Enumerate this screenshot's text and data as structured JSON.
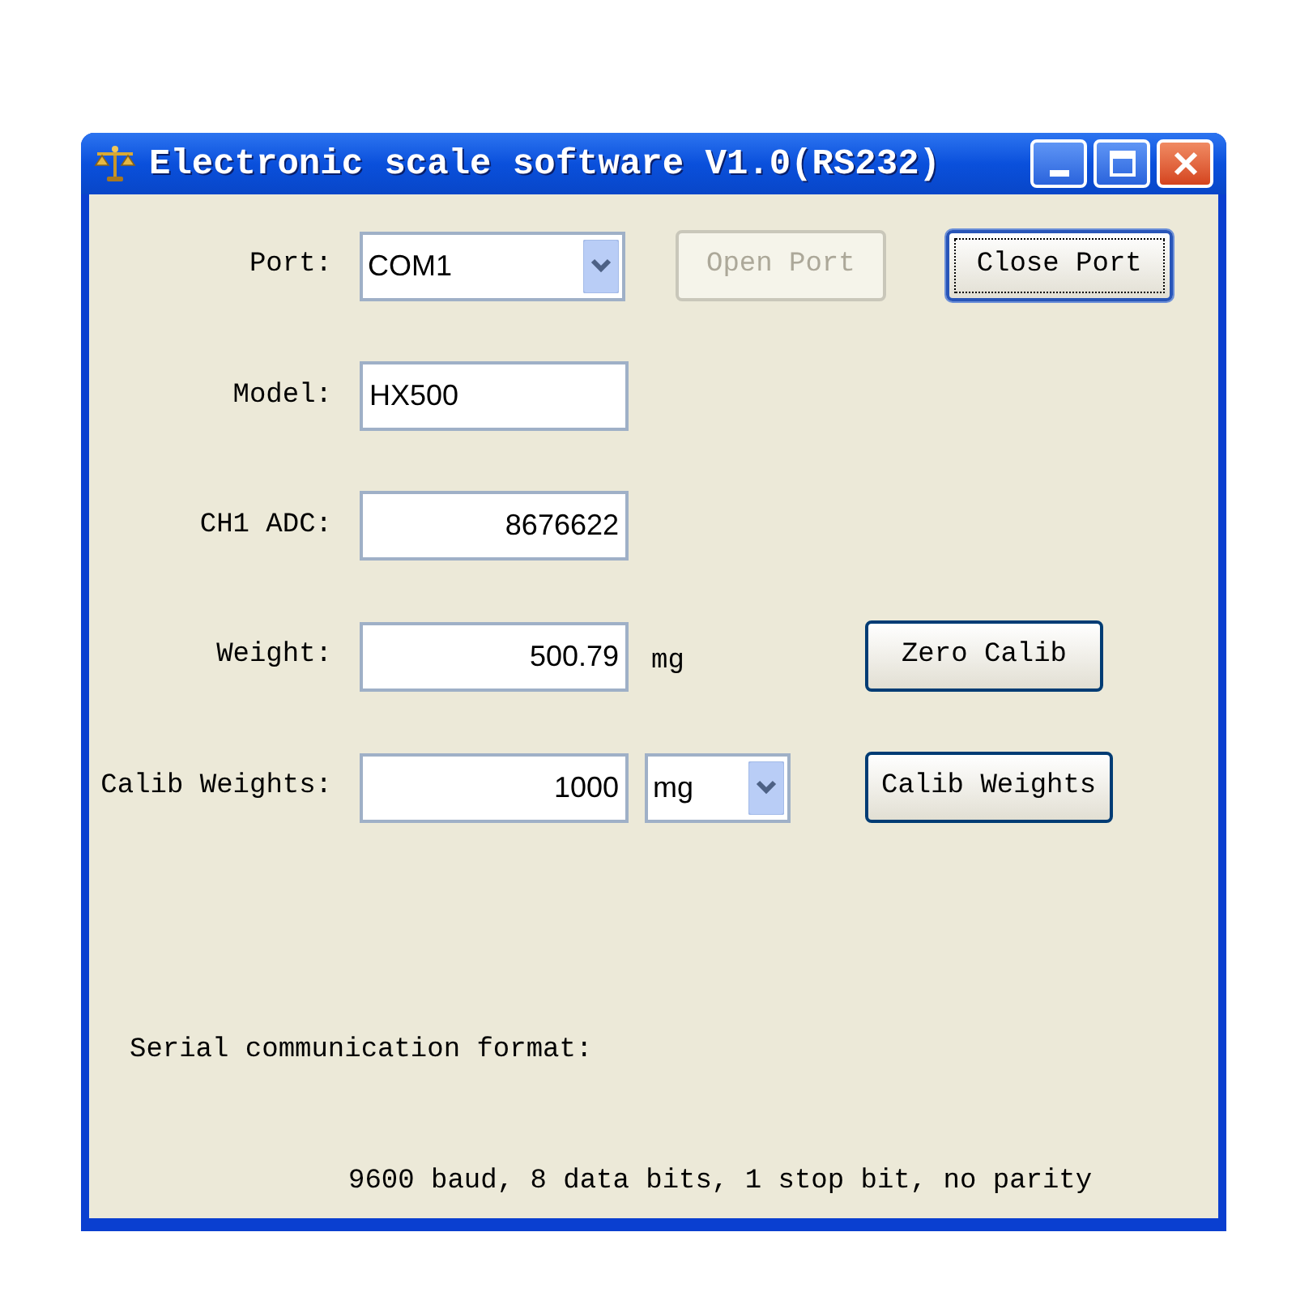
{
  "window": {
    "title": "Electronic scale software V1.0(RS232)"
  },
  "rows": [
    {
      "label": "Port:",
      "field": {
        "kind": "combo",
        "value": "COM1"
      },
      "buttons": [
        {
          "label": "Open Port",
          "disabled": true,
          "focused": false
        },
        {
          "label": "Close Port",
          "disabled": false,
          "focused": true
        }
      ]
    },
    {
      "label": "Model:",
      "field": {
        "kind": "text",
        "value": "HX500"
      }
    },
    {
      "label": "CH1 ADC:",
      "field": {
        "kind": "number",
        "value": "8676622"
      }
    },
    {
      "label": "Weight:",
      "field": {
        "kind": "number",
        "value": "500.79"
      },
      "unit": {
        "kind": "text",
        "value": "mg"
      },
      "buttons": [
        {
          "label": "Zero Calib",
          "disabled": false,
          "focused": false
        }
      ]
    },
    {
      "label": "Calib Weights:",
      "field": {
        "kind": "number",
        "value": "1000"
      },
      "unit": {
        "kind": "combo",
        "value": "mg"
      },
      "buttons": [
        {
          "label": "Calib Weights",
          "disabled": false,
          "focused": false
        }
      ]
    }
  ],
  "serial_format": {
    "heading": "Serial communication format:",
    "details": "9600 baud, 8 data bits, 1 stop bit, no parity"
  }
}
